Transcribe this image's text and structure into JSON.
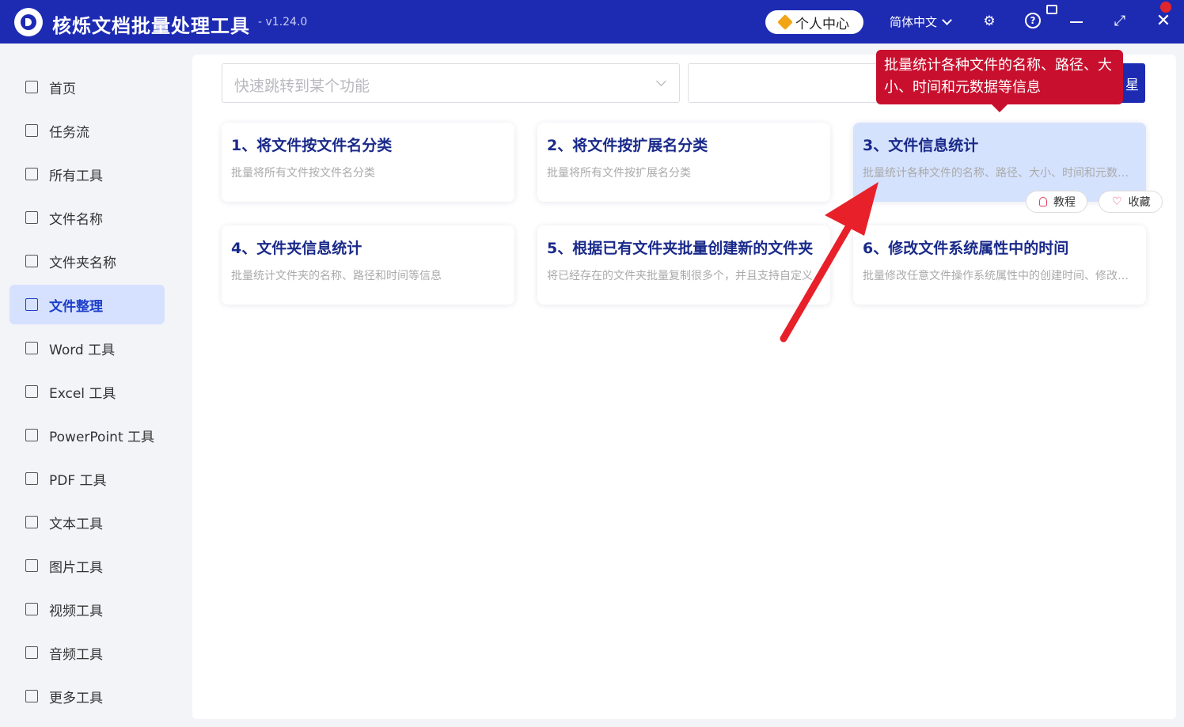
{
  "app": {
    "title": "核烁文档批量处理工具",
    "version": "- v1.24.0",
    "user_center": "个人中心",
    "language": "简体中文"
  },
  "sidebar": {
    "items": [
      {
        "label": "首页",
        "icon": "home-icon"
      },
      {
        "label": "任务流",
        "icon": "workflow-icon"
      },
      {
        "label": "所有工具",
        "icon": "monitor-icon"
      },
      {
        "label": "文件名称",
        "icon": "file-name-icon"
      },
      {
        "label": "文件夹名称",
        "icon": "folder-icon"
      },
      {
        "label": "文件整理",
        "icon": "organize-icon",
        "active": true
      },
      {
        "label": "Word 工具",
        "icon": "word-icon"
      },
      {
        "label": "Excel 工具",
        "icon": "excel-icon"
      },
      {
        "label": "PowerPoint 工具",
        "icon": "powerpoint-icon"
      },
      {
        "label": "PDF 工具",
        "icon": "pdf-icon"
      },
      {
        "label": "文本工具",
        "icon": "text-icon"
      },
      {
        "label": "图片工具",
        "icon": "image-icon"
      },
      {
        "label": "视频工具",
        "icon": "video-icon"
      },
      {
        "label": "音频工具",
        "icon": "audio-icon"
      },
      {
        "label": "更多工具",
        "icon": "grid-icon"
      }
    ]
  },
  "search": {
    "placeholder": "快速跳转到某个功能",
    "button_label": "星"
  },
  "cards": [
    {
      "title": "1、将文件按文件名分类",
      "desc": "批量将所有文件按文件名分类"
    },
    {
      "title": "2、将文件按扩展名分类",
      "desc": "批量将所有文件按扩展名分类"
    },
    {
      "title": "3、文件信息统计",
      "desc": "批量统计各种文件的名称、路径、大小、时间和元数据等信息",
      "highlight": true
    },
    {
      "title": "4、文件夹信息统计",
      "desc": "批量统计文件夹的名称、路径和时间等信息"
    },
    {
      "title": "5、根据已有文件夹批量创建新的文件夹",
      "desc": "将已经存在的文件夹批量复制很多个，并且支持自定义"
    },
    {
      "title": "6、修改文件系统属性中的时间",
      "desc": "批量修改任意文件操作系统属性中的创建时间、修改时间"
    }
  ],
  "card_actions": {
    "tutorial": "教程",
    "favorite": "收藏"
  },
  "tooltip": {
    "text": "批量统计各种文件的名称、路径、大小、时间和元数据等信息"
  },
  "colors": {
    "brand": "#1d2bb3",
    "active_bg": "#d6e1ff",
    "tooltip": "#c8102e",
    "arrow": "#e8202a"
  }
}
